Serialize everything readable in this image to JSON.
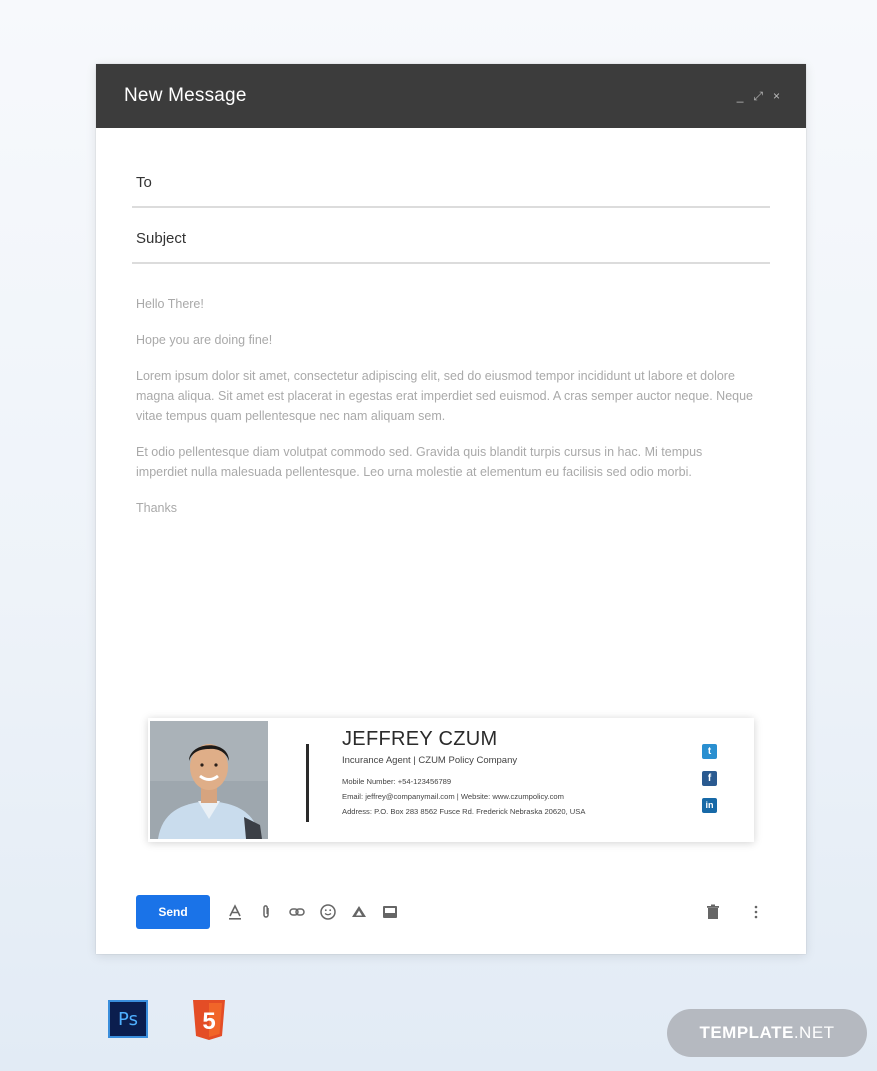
{
  "window": {
    "title": "New Message",
    "controls": {
      "minimize": "_",
      "expand": "⤢",
      "close": "×"
    }
  },
  "compose": {
    "to_label": "To",
    "to_value": "",
    "subject_label": "Subject",
    "subject_value": "",
    "body": [
      "Hello There!",
      "Hope you are doing fine!",
      "Lorem ipsum dolor sit amet, consectetur adipiscing elit, sed do eiusmod tempor incididunt ut labore et dolore magna aliqua. Sit amet est placerat in egestas erat imperdiet sed euismod. A cras semper auctor neque. Neque vitae tempus quam pellentesque nec nam aliquam sem.",
      " Et odio pellentesque diam volutpat commodo sed. Gravida quis blandit turpis cursus in hac. Mi tempus imperdiet nulla malesuada pellentesque. Leo urna molestie at elementum eu facilisis sed odio morbi.",
      "Thanks"
    ]
  },
  "signature": {
    "name": "JEFFREY CZUM",
    "role": "Incurance Agent  |  CZUM Policy Company",
    "mobile": "Mobile Number: +54-123456789",
    "email_web": "Email: jeffrey@companymail.com  |  Website: www.czumpolicy.com",
    "address": "Address: P.O. Box 283 8562 Fusce Rd. Frederick  Nebraska 20620, USA",
    "social": {
      "twitter_glyph": "t",
      "facebook_glyph": "f",
      "linkedin_glyph": "in"
    }
  },
  "toolbar": {
    "send_label": "Send",
    "icons": [
      "format-text-icon",
      "attach-icon",
      "link-icon",
      "emoji-icon",
      "drive-icon",
      "photo-icon"
    ],
    "right_icons": [
      "trash-icon",
      "more-options-icon"
    ]
  },
  "footer": {
    "ps_label": "Ps",
    "html5_label": "5",
    "brand_strong": "TEMPLATE",
    "brand_light": ".NET"
  },
  "colors": {
    "titlebar": "#3c3c3c",
    "send_button": "#1a73e8",
    "twitter": "#2a8fd0",
    "facebook": "#2a5a90",
    "linkedin": "#1769a7",
    "html5": "#e44d26"
  }
}
